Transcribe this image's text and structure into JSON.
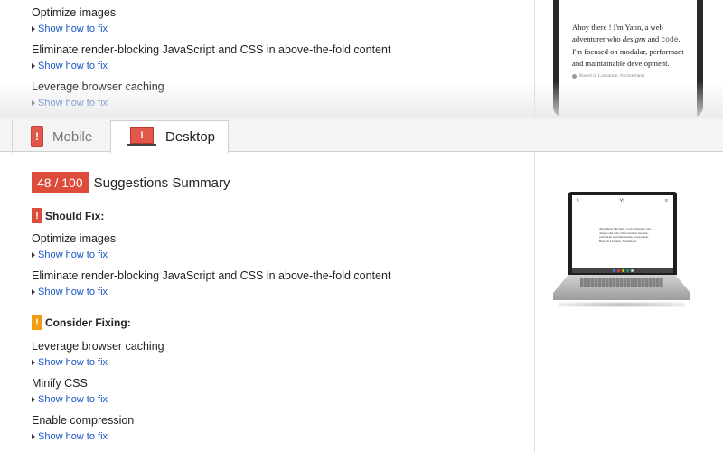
{
  "top_list": [
    {
      "title": "Optimize images",
      "link": "Show how to fix"
    },
    {
      "title": "Eliminate render-blocking JavaScript and CSS in above-the-fold content",
      "link": "Show how to fix"
    },
    {
      "title": "Leverage browser caching",
      "link": "Show how to fix"
    }
  ],
  "mobile_preview": {
    "line_start": "Ahoy there ! I'm Yann, a web adventurer who ",
    "designs": "designs",
    "and": " and ",
    "code": "code",
    "line_end": ". I'm focused on modular, performant and maintainable development.",
    "location": "Based in Lausanne, Switzerland"
  },
  "tabs": {
    "mobile": {
      "label": "Mobile"
    },
    "desktop": {
      "label": "Desktop"
    }
  },
  "summary": {
    "score": "48 / 100",
    "title": "Suggestions Summary"
  },
  "should_fix": {
    "icon_glyph": "!",
    "heading": "Should Fix:",
    "items": [
      {
        "title": "Optimize images",
        "link": "Show how to fix"
      },
      {
        "title": "Eliminate render-blocking JavaScript and CSS in above-the-fold content",
        "link": "Show how to fix"
      }
    ]
  },
  "consider_fixing": {
    "icon_glyph": "!",
    "heading": "Consider Fixing:",
    "items": [
      {
        "title": "Leverage browser caching",
        "link": "Show how to fix"
      },
      {
        "title": "Minify CSS",
        "link": "Show how to fix"
      },
      {
        "title": "Enable compression",
        "link": "Show how to fix"
      }
    ]
  },
  "desktop_preview": {
    "logo": "Yl",
    "body": "Ahoy there! I'm Yann, a web adventurer who designs and code. I'm focused on modular, performant and maintainable development.",
    "location": "Based in Lausanne, Switzerland"
  },
  "colors": {
    "score_bg": "#dd4b39",
    "should_fix": "#dd4b39",
    "consider_fixing": "#f39c12",
    "link": "#1a57c4"
  },
  "icons": {
    "mobile_tab": "mobile-phone-warning-icon",
    "desktop_tab": "laptop-warning-icon",
    "link_arrow": "triangle-right-icon",
    "should_fix": "exclamation-badge-icon",
    "consider_fixing": "exclamation-badge-icon"
  }
}
